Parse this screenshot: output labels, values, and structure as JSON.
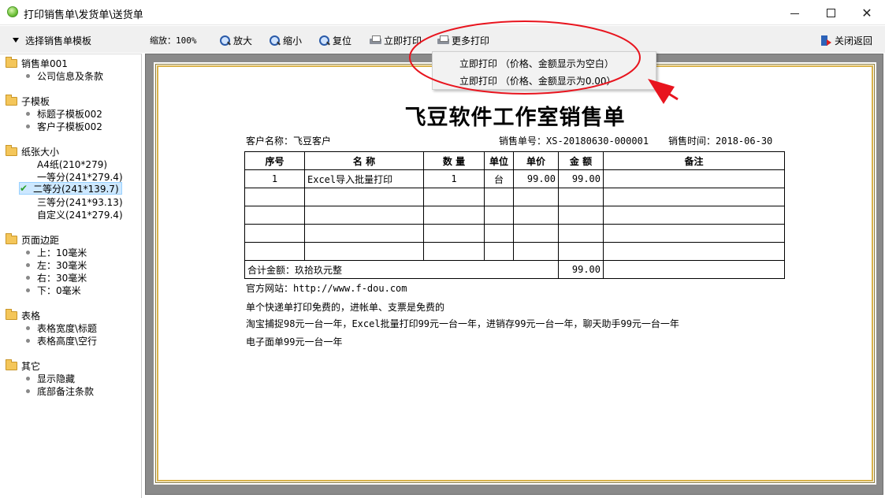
{
  "window": {
    "title": "打印销售单\\发货单\\送货单"
  },
  "toolbar": {
    "template_select": "选择销售单模板",
    "zoom_label": "缩放：100%",
    "zoom_in": "放大",
    "zoom_out": "缩小",
    "reset": "复位",
    "print_now": "立即打印",
    "more_print": "更多打印",
    "close_return": "关闭返回"
  },
  "dropdown": {
    "items": [
      "立即打印 （价格、金额显示为空白）",
      "立即打印 （价格、金额显示为0.00）"
    ]
  },
  "sidebar": {
    "groups": [
      {
        "label": "销售单001",
        "items": [
          "公司信息及条款"
        ]
      },
      {
        "label": "子模板",
        "items": [
          "标题子模板002",
          "客户子模板002"
        ]
      },
      {
        "label": "纸张大小",
        "items": [
          "A4纸(210*279)",
          "一等分(241*279.4)",
          "二等分(241*139.7)",
          "三等分(241*93.13)",
          "自定义(241*279.4)"
        ],
        "selected": "二等分(241*139.7)"
      },
      {
        "label": "页面边距",
        "items": [
          "上：10毫米",
          "左：30毫米",
          "右：30毫米",
          "下：0毫米"
        ]
      },
      {
        "label": "表格",
        "items": [
          "表格宽度\\标题",
          "表格高度\\空行"
        ]
      },
      {
        "label": "其它",
        "items": [
          "显示隐藏",
          "底部备注条款"
        ]
      }
    ]
  },
  "document": {
    "title": "飞豆软件工作室销售单",
    "customer_label": "客户名称：",
    "customer": "飞豆客户",
    "order_no_label": "销售单号：",
    "order_no": "XS-20180630-000001",
    "date_label": "销售时间：",
    "date": "2018-06-30",
    "columns": [
      "序号",
      "名 称",
      "数 量",
      "单位",
      "单价",
      "金 额",
      "备注"
    ],
    "rows": [
      [
        "1",
        "Excel导入批量打印",
        "1",
        "台",
        "99.00",
        "99.00",
        ""
      ],
      [
        "",
        "",
        "",
        "",
        "",
        "",
        ""
      ],
      [
        "",
        "",
        "",
        "",
        "",
        "",
        ""
      ],
      [
        "",
        "",
        "",
        "",
        "",
        "",
        ""
      ],
      [
        "",
        "",
        "",
        "",
        "",
        "",
        ""
      ]
    ],
    "total_label": "合计金额：玖拾玖元整",
    "total_amount": "99.00",
    "footer_lines": [
      "官方网站：http://www.f-dou.com",
      "单个快递单打印免费的，进帐单、支票是免费的",
      "淘宝捕捉98元一台一年，Excel批量打印99元一台一年，进销存99元一台一年，聊天助手99元一台一年",
      "电子面单99元一台一年"
    ]
  },
  "colors": {
    "annotation": "#e8141e",
    "paper_border": "#d9b24a",
    "preview_bg": "#8a8a8a",
    "selected_bg": "#cde8ff"
  }
}
